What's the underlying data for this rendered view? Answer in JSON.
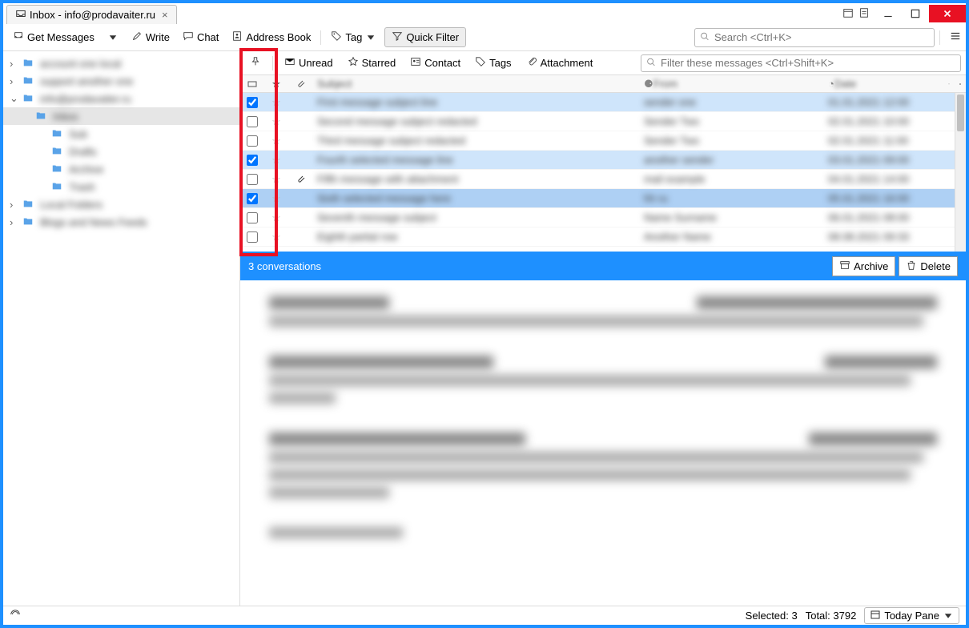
{
  "window": {
    "tab_title": "Inbox - info@prodavaiter.ru"
  },
  "toolbar": {
    "get_messages": "Get Messages",
    "write": "Write",
    "chat": "Chat",
    "address_book": "Address Book",
    "tag": "Tag",
    "quick_filter": "Quick Filter",
    "search_placeholder": "Search <Ctrl+K>"
  },
  "filterbar": {
    "unread": "Unread",
    "starred": "Starred",
    "contact": "Contact",
    "tags": "Tags",
    "attachment": "Attachment",
    "filter_placeholder": "Filter these messages <Ctrl+Shift+K>"
  },
  "columns": {
    "subject": "",
    "from": "",
    "date": ""
  },
  "folders": [
    {
      "lev": 0,
      "chev": "›",
      "txt": "account one local"
    },
    {
      "lev": 0,
      "chev": "›",
      "txt": "support another one"
    },
    {
      "lev": 0,
      "chev": "⌄",
      "txt": "info@prodavaiter.ru"
    },
    {
      "lev": 1,
      "chev": "",
      "txt": "Inbox",
      "sel": true
    },
    {
      "lev": 2,
      "chev": "",
      "txt": "Sub"
    },
    {
      "lev": 2,
      "chev": "",
      "txt": "Drafts"
    },
    {
      "lev": 2,
      "chev": "",
      "txt": "Archive"
    },
    {
      "lev": 2,
      "chev": "",
      "txt": "Trash"
    },
    {
      "lev": 0,
      "chev": "›",
      "txt": "Local Folders"
    },
    {
      "lev": 0,
      "chev": "›",
      "txt": "Blogs and News Feeds"
    }
  ],
  "messages": [
    {
      "checked": true,
      "star": false,
      "attach": false,
      "subject": "First message subject line",
      "from": "sender one",
      "date": "01.01.2021 12:00",
      "sel": true
    },
    {
      "checked": false,
      "star": false,
      "attach": false,
      "subject": "Second message subject redacted",
      "from": "Sender Two",
      "date": "02.01.2021 10:00",
      "sel": false
    },
    {
      "checked": false,
      "star": false,
      "attach": false,
      "subject": "Third message subject redacted",
      "from": "Sender Two",
      "date": "02.01.2021 11:00",
      "sel": false
    },
    {
      "checked": true,
      "star": false,
      "attach": false,
      "subject": "Fourth selected message line",
      "from": "another sender",
      "date": "03.01.2021 09:00",
      "sel": true
    },
    {
      "checked": false,
      "star": false,
      "attach": true,
      "subject": "Fifth message with attachment",
      "from": "mail example",
      "date": "04.01.2021 14:00",
      "sel": false
    },
    {
      "checked": true,
      "star": false,
      "attach": false,
      "subject": "Sixth selected message here",
      "from": "hh ru",
      "date": "05.01.2021 16:00",
      "sel": "sel2"
    },
    {
      "checked": false,
      "star": false,
      "attach": false,
      "subject": "Seventh message subject",
      "from": "Name Surname",
      "date": "06.01.2021 08:00",
      "sel": false
    },
    {
      "checked": false,
      "star": false,
      "attach": false,
      "subject": "Eighth partial row",
      "from": "Another Name",
      "date": "08.08.2021 09:33",
      "sel": false
    }
  ],
  "conversation_bar": {
    "title": "3 conversations",
    "archive": "Archive",
    "delete": "Delete"
  },
  "statusbar": {
    "selected": "Selected: 3",
    "total": "Total: 3792",
    "today_pane": "Today Pane"
  }
}
